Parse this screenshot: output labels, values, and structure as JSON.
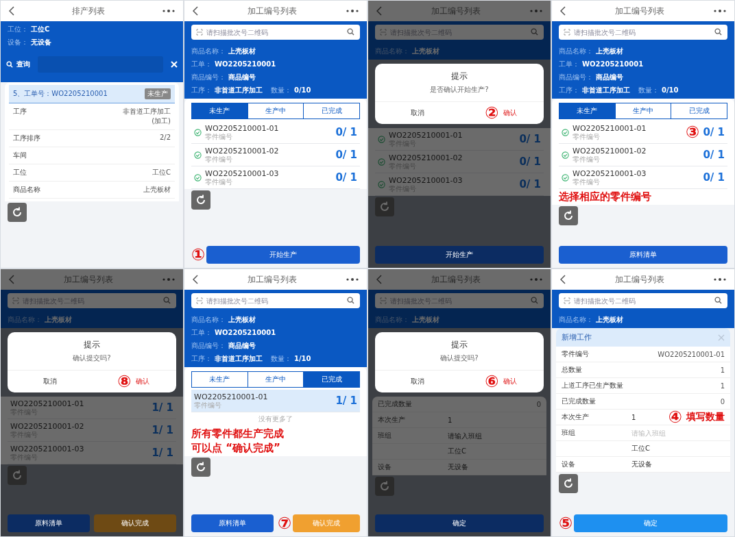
{
  "panels": [
    {
      "title": "排产列表",
      "dimmed": false,
      "blocks": [
        {
          "kind": "info",
          "lines": [
            {
              "items": [
                {
                  "label": "工位：",
                  "value": "工位C"
                }
              ]
            },
            {
              "items": [
                {
                  "label": "设备：",
                  "value": "无设备"
                }
              ]
            }
          ]
        },
        {
          "kind": "query",
          "label": "查询"
        },
        {
          "kind": "card",
          "title": "5、工单号：WO2205210001",
          "badge": "未生产",
          "rows": [
            {
              "label": "工序",
              "value": "非首道工序加工(加工)"
            },
            {
              "label": "工序排序",
              "value": "2/2"
            },
            {
              "label": "车间"
            },
            {
              "label": "工位",
              "value": "工位C"
            },
            {
              "label": "商品名称",
              "value": "上壳板材"
            }
          ]
        },
        {
          "kind": "refresh"
        }
      ]
    },
    {
      "title": "加工编号列表",
      "dimmed": false,
      "blocks": [
        {
          "kind": "search",
          "placeholder": "请扫描批次号二维码"
        },
        {
          "kind": "info",
          "lines": [
            {
              "items": [
                {
                  "label": "商品名称：",
                  "value": "上壳板材"
                }
              ]
            },
            {
              "items": [
                {
                  "label": "工单：",
                  "value": "WO2205210001"
                }
              ]
            },
            {
              "items": [
                {
                  "label": "商品编号：",
                  "value": "商品编号"
                }
              ]
            },
            {
              "items": [
                {
                  "label": "工序：",
                  "value": "非首道工序加工"
                },
                {
                  "label": "数量：",
                  "value": "0/10"
                }
              ]
            }
          ]
        },
        {
          "kind": "tabs",
          "tabs": [
            {
              "label": "未生产",
              "selected": true
            },
            {
              "label": "生产中",
              "selected": false
            },
            {
              "label": "已完成",
              "selected": false
            }
          ]
        },
        {
          "kind": "list",
          "rows": [
            {
              "code": "WO2205210001-01",
              "sub": "零件编号",
              "count": "0/ 1",
              "checked": true,
              "selected": false
            },
            {
              "code": "WO2205210001-02",
              "sub": "零件编号",
              "count": "0/ 1",
              "checked": true,
              "selected": false
            },
            {
              "code": "WO2205210001-03",
              "sub": "零件编号",
              "count": "0/ 1",
              "checked": true,
              "selected": false
            }
          ]
        },
        {
          "kind": "refresh"
        },
        {
          "kind": "buttons",
          "buttons": [
            {
              "label": "开始生产",
              "color": "#1a5fd0",
              "marker": "①"
            }
          ]
        }
      ]
    },
    {
      "title": "加工编号列表",
      "dimmed": true,
      "blocks": [
        {
          "kind": "search",
          "placeholder": "请扫描批次号二维码"
        },
        {
          "kind": "info",
          "lines": [
            {
              "items": [
                {
                  "label": "商品名称：",
                  "value": "上壳板材"
                }
              ]
            }
          ]
        },
        {
          "kind": "dialog",
          "title": "提示",
          "message": "是否确认开始生产?",
          "cancel": "取消",
          "confirm": "确认",
          "marker": "②"
        },
        {
          "kind": "list",
          "rows": [
            {
              "code": "WO2205210001-01",
              "sub": "零件编号",
              "count": "0/ 1",
              "checked": true,
              "selected": false
            },
            {
              "code": "WO2205210001-02",
              "sub": "零件编号",
              "count": "0/ 1",
              "checked": true,
              "selected": false
            },
            {
              "code": "WO2205210001-03",
              "sub": "零件编号",
              "count": "0/ 1",
              "checked": true,
              "selected": false
            }
          ]
        },
        {
          "kind": "refresh"
        },
        {
          "kind": "buttons",
          "buttons": [
            {
              "label": "开始生产",
              "color": "#0c2c62"
            }
          ]
        }
      ]
    },
    {
      "title": "加工编号列表",
      "dimmed": false,
      "blocks": [
        {
          "kind": "search",
          "placeholder": "请扫描批次号二维码"
        },
        {
          "kind": "info",
          "lines": [
            {
              "items": [
                {
                  "label": "商品名称：",
                  "value": "上壳板材"
                }
              ]
            },
            {
              "items": [
                {
                  "label": "工单：",
                  "value": "WO2205210001"
                }
              ]
            },
            {
              "items": [
                {
                  "label": "商品编号：",
                  "value": "商品编号"
                }
              ]
            },
            {
              "items": [
                {
                  "label": "工序：",
                  "value": "非首道工序加工"
                },
                {
                  "label": "数量：",
                  "value": "0/10"
                }
              ]
            }
          ]
        },
        {
          "kind": "tabs",
          "tabs": [
            {
              "label": "未生产",
              "selected": true
            },
            {
              "label": "生产中",
              "selected": false
            },
            {
              "label": "已完成",
              "selected": false
            }
          ]
        },
        {
          "kind": "list",
          "rows": [
            {
              "code": "WO2205210001-01",
              "sub": "零件编号",
              "count": "0/ 1",
              "checked": true,
              "selected": false,
              "marker": "③"
            },
            {
              "code": "WO2205210001-02",
              "sub": "零件编号",
              "count": "0/ 1",
              "checked": true,
              "selected": false
            },
            {
              "code": "WO2205210001-03",
              "sub": "零件编号",
              "count": "0/ 1",
              "checked": true,
              "selected": false
            }
          ]
        },
        {
          "kind": "note",
          "lines": [
            "选择相应的零件编号"
          ]
        },
        {
          "kind": "refresh"
        },
        {
          "kind": "buttons",
          "buttons": [
            {
              "label": "原料清单",
              "color": "#1a5fd0"
            }
          ]
        }
      ]
    },
    {
      "title": "加工编号列表",
      "dimmed": true,
      "blocks": [
        {
          "kind": "search",
          "placeholder": "请扫描批次号二维码"
        },
        {
          "kind": "info",
          "lines": [
            {
              "items": [
                {
                  "label": "商品名称：",
                  "value": "上壳板材"
                }
              ]
            }
          ]
        },
        {
          "kind": "dialog",
          "title": "提示",
          "message": "确认提交吗?",
          "cancel": "取消",
          "confirm": "确认",
          "marker": "⑧"
        },
        {
          "kind": "list",
          "rows": [
            {
              "code": "WO2205210001-01",
              "sub": "零件编号",
              "count": "1/ 1",
              "checked": false,
              "selected": false
            },
            {
              "code": "WO2205210001-02",
              "sub": "零件编号",
              "count": "1/ 1",
              "checked": false,
              "selected": false
            },
            {
              "code": "WO2205210001-03",
              "sub": "零件编号",
              "count": "1/ 1",
              "checked": false,
              "selected": false
            }
          ]
        },
        {
          "kind": "refresh"
        },
        {
          "kind": "buttons",
          "buttons": [
            {
              "label": "原料清单",
              "color": "#0c2c62"
            },
            {
              "label": "确认完成",
              "color": "#6e4a14"
            }
          ]
        }
      ]
    },
    {
      "title": "加工编号列表",
      "dimmed": false,
      "blocks": [
        {
          "kind": "search",
          "placeholder": "请扫描批次号二维码"
        },
        {
          "kind": "info",
          "lines": [
            {
              "items": [
                {
                  "label": "商品名称：",
                  "value": "上壳板材"
                }
              ]
            },
            {
              "items": [
                {
                  "label": "工单：",
                  "value": "WO2205210001"
                }
              ]
            },
            {
              "items": [
                {
                  "label": "商品编号：",
                  "value": "商品编号"
                }
              ]
            },
            {
              "items": [
                {
                  "label": "工序：",
                  "value": "非首道工序加工"
                },
                {
                  "label": "数量：",
                  "value": "1/10"
                }
              ]
            }
          ]
        },
        {
          "kind": "tabs",
          "tabs": [
            {
              "label": "未生产",
              "selected": false
            },
            {
              "label": "生产中",
              "selected": false
            },
            {
              "label": "已完成",
              "selected": true
            }
          ]
        },
        {
          "kind": "list",
          "rows": [
            {
              "code": "WO2205210001-01",
              "sub": "零件编号",
              "count": "1/ 1",
              "checked": false,
              "selected": true
            }
          ]
        },
        {
          "kind": "end",
          "text": "没有更多了"
        },
        {
          "kind": "note",
          "lines": [
            "所有零件都生产完成",
            "可以点 “确认完成”"
          ]
        },
        {
          "kind": "refresh"
        },
        {
          "kind": "buttons",
          "buttons": [
            {
              "label": "原料清单",
              "color": "#1a5fd0"
            },
            {
              "label": "确认完成",
              "color": "#f0a030",
              "marker": "⑦"
            }
          ]
        }
      ]
    },
    {
      "title": "加工编号列表",
      "dimmed": true,
      "blocks": [
        {
          "kind": "search",
          "placeholder": "请扫描批次号二维码"
        },
        {
          "kind": "info",
          "lines": [
            {
              "items": [
                {
                  "label": "商品名称：",
                  "value": "上壳板材"
                }
              ]
            }
          ]
        },
        {
          "kind": "dialog",
          "title": "提示",
          "message": "确认提交吗?",
          "cancel": "取消",
          "confirm": "确认",
          "marker": "⑥"
        },
        {
          "kind": "form",
          "rows": [
            {
              "kind": "readonly",
              "label": "已完成数量",
              "value": "0"
            },
            {
              "kind": "input",
              "label": "本次生产",
              "value": "1"
            },
            {
              "kind": "input",
              "label": "班组",
              "placeholder": "请输入班组"
            },
            {
              "kind": "input",
              "value": "工位C"
            },
            {
              "kind": "input",
              "label": "设备",
              "value": "无设备"
            }
          ]
        },
        {
          "kind": "refresh"
        },
        {
          "kind": "buttons",
          "buttons": [
            {
              "label": "确定",
              "color": "#0c2c62"
            }
          ]
        }
      ]
    },
    {
      "title": "加工编号列表",
      "dimmed": false,
      "blocks": [
        {
          "kind": "search",
          "placeholder": "请扫描批次号二维码"
        },
        {
          "kind": "info",
          "lines": [
            {
              "items": [
                {
                  "label": "商品名称：",
                  "value": "上壳板材"
                }
              ]
            }
          ]
        },
        {
          "kind": "form",
          "title": "新增工作",
          "rows": [
            {
              "kind": "readonly",
              "label": "零件编号",
              "value": "WO2205210001-01"
            },
            {
              "kind": "readonly",
              "label": "总数量",
              "value": "1"
            },
            {
              "kind": "readonly",
              "label": "上道工序已生产数量",
              "value": "1"
            },
            {
              "kind": "readonly",
              "label": "已完成数量",
              "value": "0"
            },
            {
              "kind": "input",
              "label": "本次生产",
              "value": "1",
              "marker": "④",
              "note": "填写数量"
            },
            {
              "kind": "input",
              "label": "班组",
              "placeholder": "请输入班组"
            },
            {
              "kind": "input",
              "value": "工位C"
            },
            {
              "kind": "input",
              "label": "设备",
              "value": "无设备"
            }
          ]
        },
        {
          "kind": "refresh"
        },
        {
          "kind": "buttons",
          "buttons": [
            {
              "label": "确定",
              "color": "#1e90f0",
              "marker": "⑤"
            }
          ]
        }
      ]
    }
  ]
}
